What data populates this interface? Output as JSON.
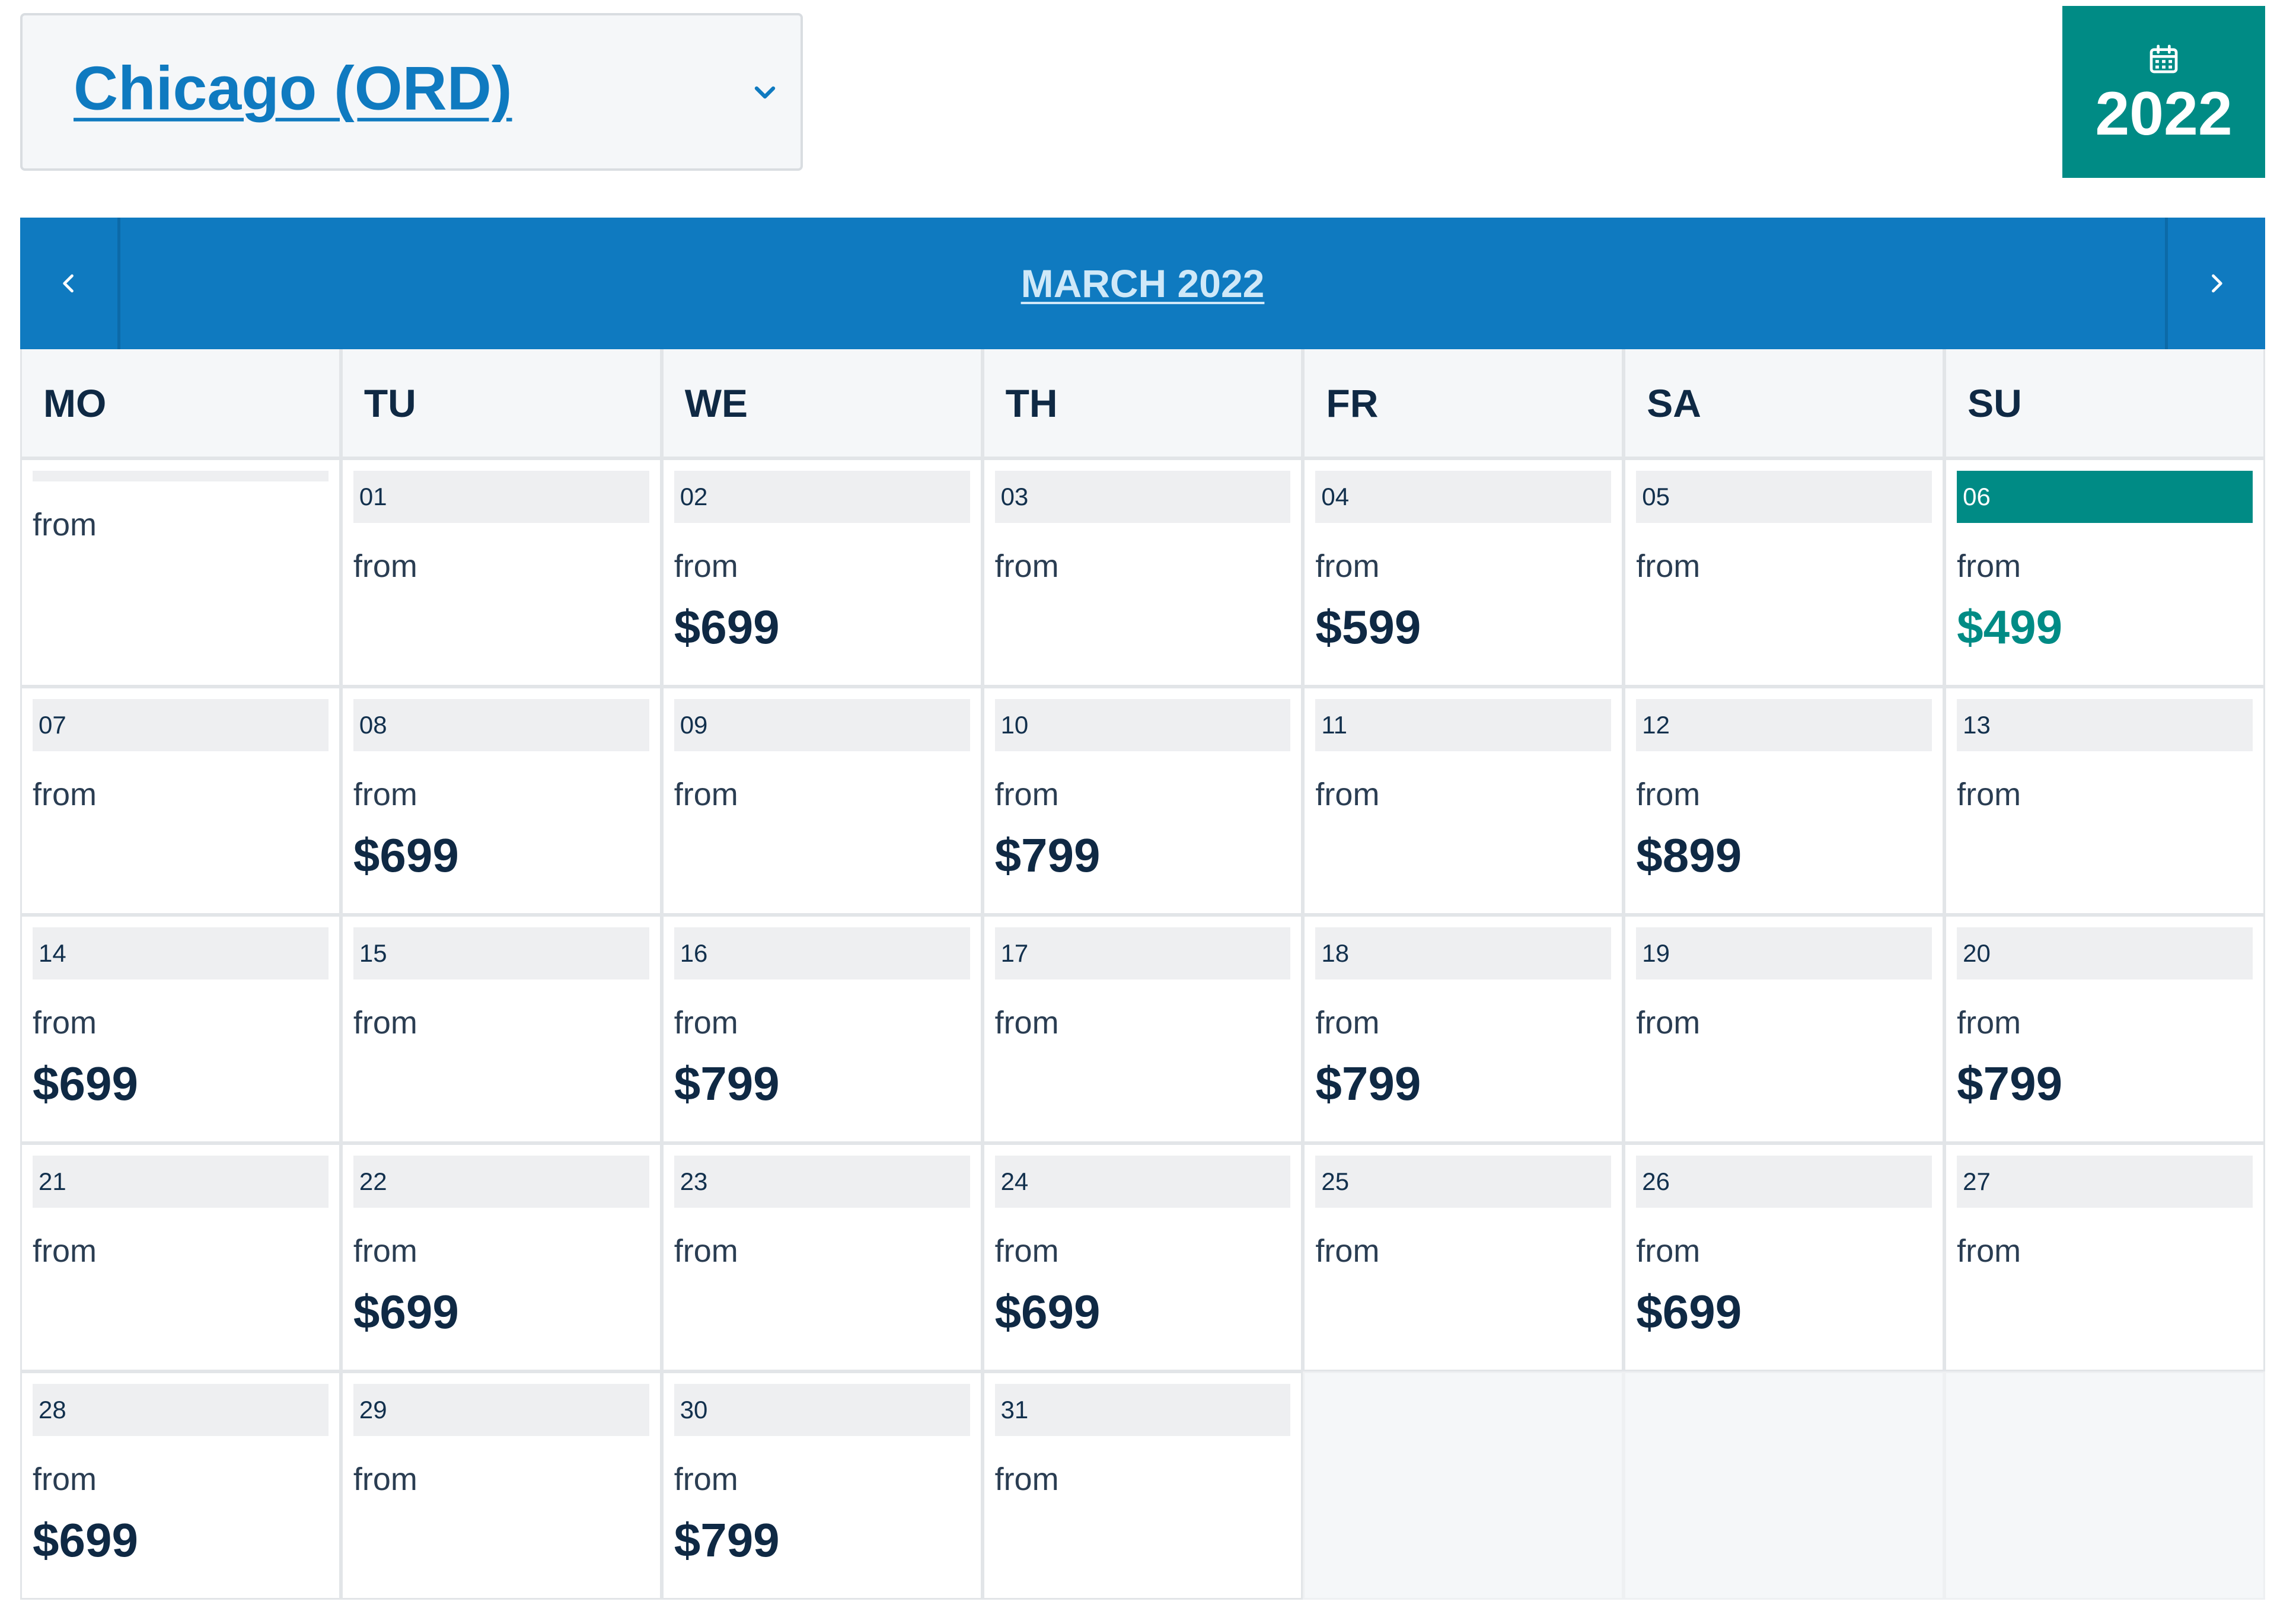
{
  "origin": {
    "label": "Chicago (ORD)",
    "chevron_icon": "chevron-down-icon"
  },
  "year_badge": {
    "year": "2022",
    "icon": "calendar-icon"
  },
  "calendar": {
    "month_title": "MARCH 2022",
    "prev_icon": "chevron-left-icon",
    "next_icon": "chevron-right-icon",
    "weekdays": [
      "MO",
      "TU",
      "WE",
      "TH",
      "FR",
      "SA",
      "SU"
    ],
    "from_label": "from",
    "days": [
      {
        "date": "",
        "price": ""
      },
      {
        "date": "01",
        "price": ""
      },
      {
        "date": "02",
        "price": "$699"
      },
      {
        "date": "03",
        "price": ""
      },
      {
        "date": "04",
        "price": "$599"
      },
      {
        "date": "05",
        "price": ""
      },
      {
        "date": "06",
        "price": "$499"
      },
      {
        "date": "07",
        "price": ""
      },
      {
        "date": "08",
        "price": "$699"
      },
      {
        "date": "09",
        "price": ""
      },
      {
        "date": "10",
        "price": "$799"
      },
      {
        "date": "11",
        "price": ""
      },
      {
        "date": "12",
        "price": "$899"
      },
      {
        "date": "13",
        "price": ""
      },
      {
        "date": "14",
        "price": "$699"
      },
      {
        "date": "15",
        "price": ""
      },
      {
        "date": "16",
        "price": "$799"
      },
      {
        "date": "17",
        "price": ""
      },
      {
        "date": "18",
        "price": "$799"
      },
      {
        "date": "19",
        "price": ""
      },
      {
        "date": "20",
        "price": "$799"
      },
      {
        "date": "21",
        "price": ""
      },
      {
        "date": "22",
        "price": "$699"
      },
      {
        "date": "23",
        "price": ""
      },
      {
        "date": "24",
        "price": "$699"
      },
      {
        "date": "25",
        "price": ""
      },
      {
        "date": "26",
        "price": "$699"
      },
      {
        "date": "27",
        "price": ""
      },
      {
        "date": "28",
        "price": "$699"
      },
      {
        "date": "29",
        "price": ""
      },
      {
        "date": "30",
        "price": "$799"
      },
      {
        "date": "31",
        "price": ""
      }
    ],
    "selected_date": "06",
    "colors": {
      "primary": "#0f7ac0",
      "accent": "#008b85",
      "text": "#0f2944"
    }
  }
}
